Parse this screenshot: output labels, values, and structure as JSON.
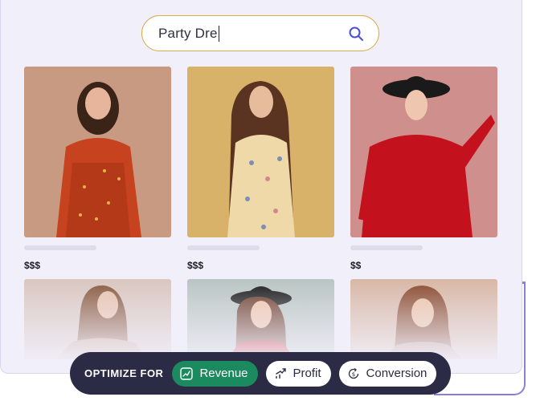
{
  "search": {
    "query": "Party Dre"
  },
  "products": [
    {
      "price": "$$$",
      "bg": "#c89a82",
      "dress": "#c7421e"
    },
    {
      "price": "$$$",
      "bg": "#d9b26a",
      "dress": "#efd9a8"
    },
    {
      "price": "$$",
      "bg": "#cf8f8c",
      "dress": "#c3111e"
    }
  ],
  "products_faded": [
    {
      "bg": "#d9c7c0"
    },
    {
      "bg": "#b9c5c2"
    },
    {
      "bg": "#d8b8a6"
    }
  ],
  "optimize": {
    "label": "OPTIMIZE FOR",
    "options": [
      "Revenue",
      "Profit",
      "Conversion"
    ]
  },
  "colors": {
    "accent": "#1b8a5f",
    "bar": "#2b2b45",
    "search_border": "#d9a94a"
  }
}
